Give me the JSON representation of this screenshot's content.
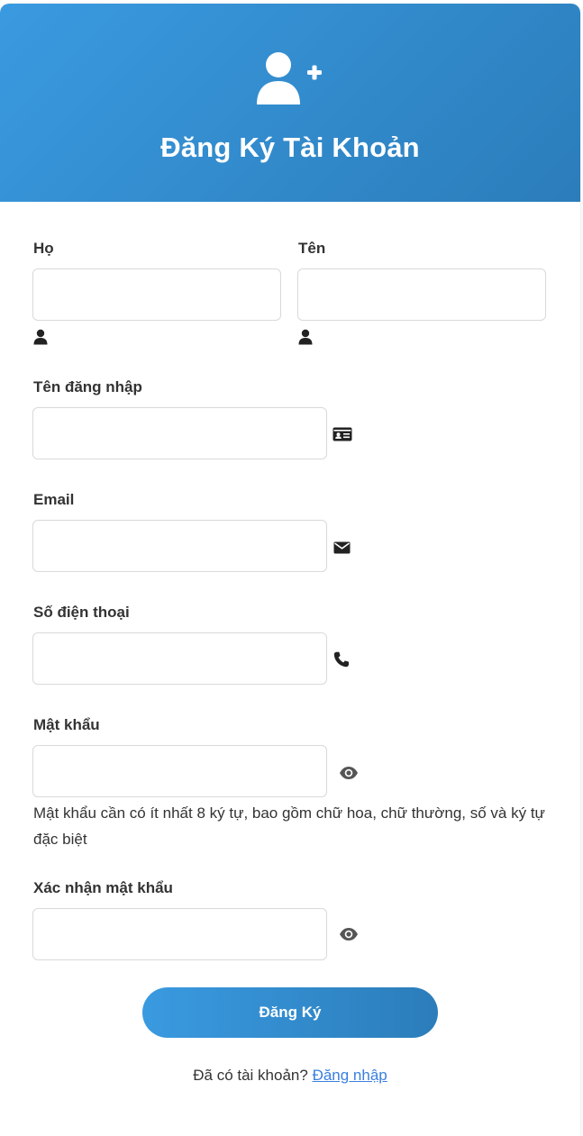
{
  "header": {
    "icon": "user-plus-icon",
    "title": "Đăng Ký Tài Khoản",
    "gradient_start": "#3a9ae0",
    "gradient_end": "#2b7dba"
  },
  "form": {
    "first_name": {
      "label": "Họ",
      "value": "",
      "icon": "user-icon"
    },
    "last_name": {
      "label": "Tên",
      "value": "",
      "icon": "user-icon"
    },
    "username": {
      "label": "Tên đăng nhập",
      "value": "",
      "icon": "id-card-icon"
    },
    "email": {
      "label": "Email",
      "value": "",
      "icon": "envelope-icon"
    },
    "phone": {
      "label": "Số điện thoại",
      "value": "",
      "icon": "phone-icon"
    },
    "password": {
      "label": "Mật khẩu",
      "value": "",
      "icon": "eye-icon",
      "hint": "Mật khẩu cần có ít nhất 8 ký tự, bao gồm chữ hoa, chữ thường, số và ký tự đặc biệt"
    },
    "confirm_password": {
      "label": "Xác nhận mật khẩu",
      "value": "",
      "icon": "eye-icon"
    },
    "submit_label": "Đăng Ký"
  },
  "footer": {
    "prompt": "Đã có tài khoản?",
    "login_link": "Đăng nhập",
    "link_color": "#3a7fe0"
  }
}
